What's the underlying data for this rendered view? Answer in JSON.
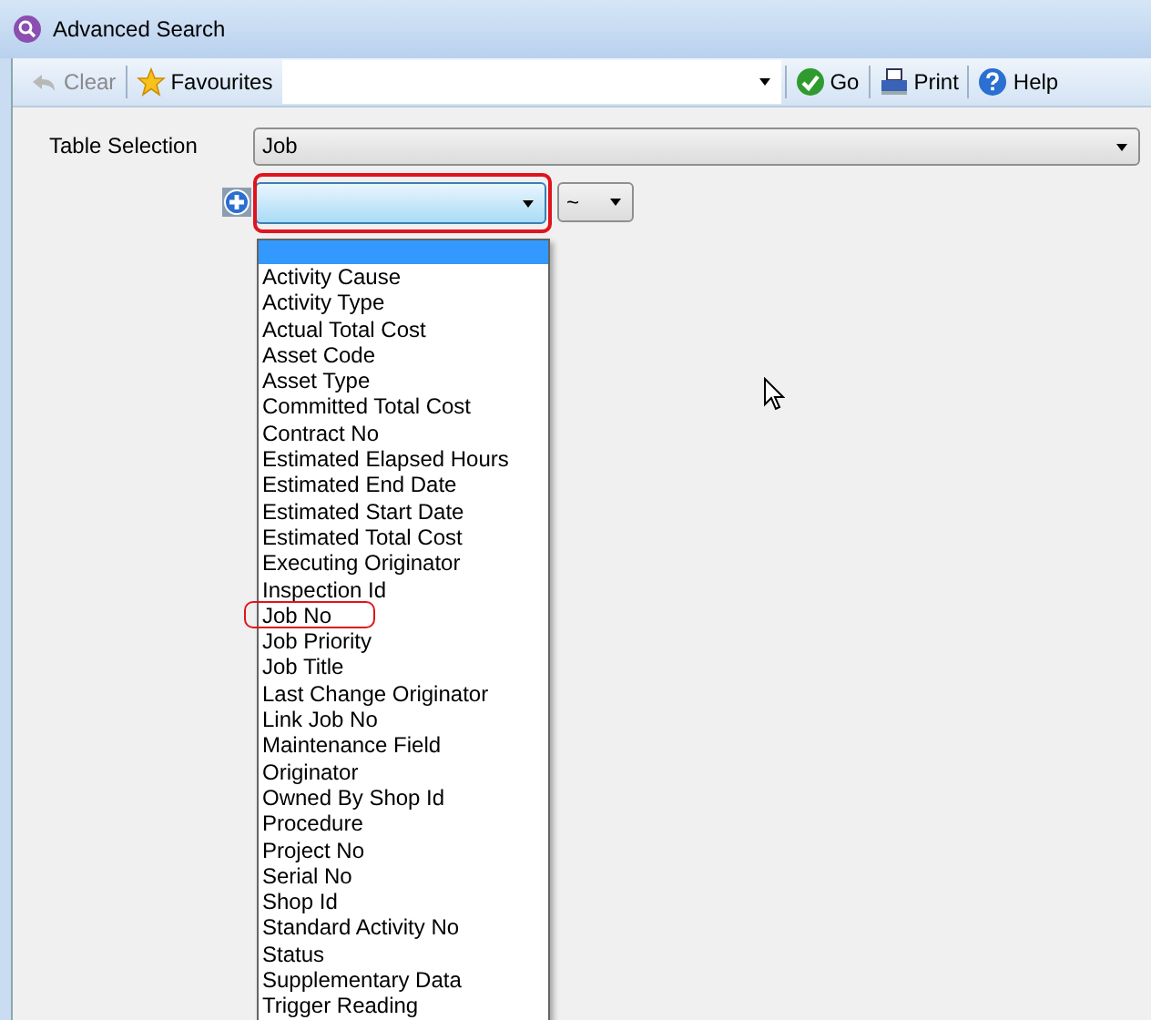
{
  "window": {
    "title": "Advanced Search"
  },
  "toolbar": {
    "items": [
      {
        "kind": "button",
        "label": "Clear",
        "disabled": true
      },
      {
        "kind": "button",
        "label": "Favourites",
        "disabled": false
      },
      {
        "kind": "combo"
      },
      {
        "kind": "button",
        "label": "Go",
        "disabled": false
      },
      {
        "kind": "button",
        "label": "Print",
        "disabled": false
      },
      {
        "kind": "button",
        "label": "Help",
        "disabled": false
      }
    ]
  },
  "table_selection": {
    "label": "Table Selection",
    "value": "Job"
  },
  "criteria": {
    "field": {
      "expanded": true,
      "highlighted": true
    },
    "operator": {
      "value": "~"
    }
  },
  "dropdown": {
    "blank_entry": {
      "selected": true
    },
    "items": [
      {
        "label": "Activity Cause",
        "highlighted": false
      },
      {
        "label": "Activity Type",
        "highlighted": false
      },
      {
        "label": "Actual Total Cost",
        "highlighted": false
      },
      {
        "label": "Asset Code",
        "highlighted": false
      },
      {
        "label": "Asset Type",
        "highlighted": false
      },
      {
        "label": "Committed Total Cost",
        "highlighted": false
      },
      {
        "label": "Contract No",
        "highlighted": false
      },
      {
        "label": "Estimated Elapsed Hours",
        "highlighted": false
      },
      {
        "label": "Estimated End Date",
        "highlighted": false
      },
      {
        "label": "Estimated Start Date",
        "highlighted": false
      },
      {
        "label": "Estimated Total Cost",
        "highlighted": false
      },
      {
        "label": "Executing Originator",
        "highlighted": false
      },
      {
        "label": "Inspection Id",
        "highlighted": false
      },
      {
        "label": "Job No",
        "highlighted": true
      },
      {
        "label": "Job Priority",
        "highlighted": false
      },
      {
        "label": "Job Title",
        "highlighted": false
      },
      {
        "label": "Last Change Originator",
        "highlighted": false
      },
      {
        "label": "Link Job No",
        "highlighted": false
      },
      {
        "label": "Maintenance Field",
        "highlighted": false
      },
      {
        "label": "Originator",
        "highlighted": false
      },
      {
        "label": "Owned By Shop Id",
        "highlighted": false
      },
      {
        "label": "Procedure",
        "highlighted": false
      },
      {
        "label": "Project No",
        "highlighted": false
      },
      {
        "label": "Serial No",
        "highlighted": false
      },
      {
        "label": "Shop Id",
        "highlighted": false
      },
      {
        "label": "Standard Activity No",
        "highlighted": false
      },
      {
        "label": "Status",
        "highlighted": false
      },
      {
        "label": "Supplementary Data",
        "highlighted": false
      },
      {
        "label": "Trigger Reading",
        "highlighted": false
      }
    ]
  }
}
